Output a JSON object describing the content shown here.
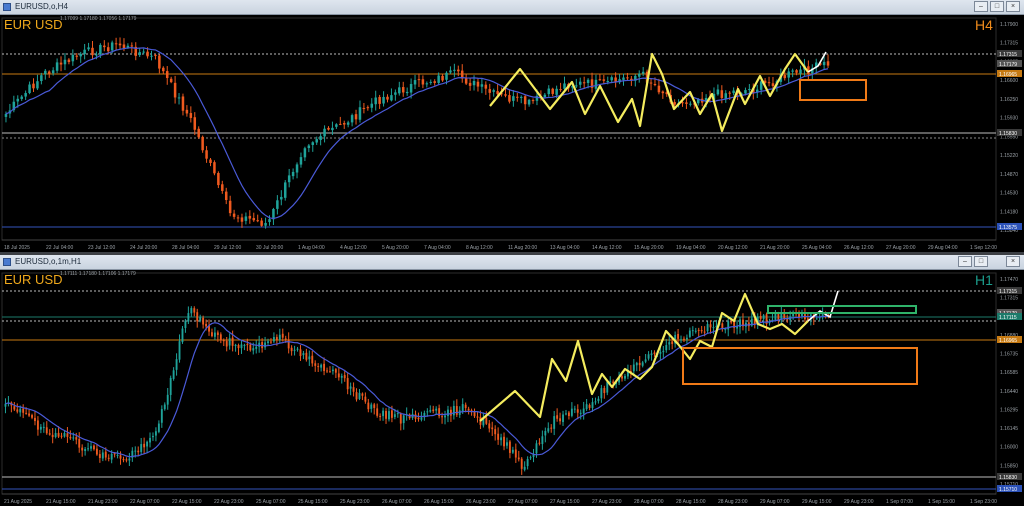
{
  "top": {
    "title": "EURUSD,o,H4",
    "symbol": "EUR USD",
    "timeframe": "H4",
    "timeframe_color": "#f08c1c",
    "ohlc": "1.17099 1.17180 1.17056 1.17179",
    "price_ticks": [
      "1.17900",
      "1.17315",
      "1.16965",
      "1.16600",
      "1.16250",
      "1.15930",
      "1.15550",
      "1.15220",
      "1.14870",
      "1.14530",
      "1.14180",
      "1.13840"
    ],
    "price_labels": [
      {
        "text": "1.17315",
        "color": "#ffffff",
        "bg": "#3a3a3a"
      },
      {
        "text": "1.17179",
        "color": "#ffffff",
        "bg": "#555555"
      },
      {
        "text": "1.16965",
        "color": "#ffffff",
        "bg": "#c77a12"
      },
      {
        "text": "1.15830",
        "color": "#ffffff",
        "bg": "#3a3a3a"
      },
      {
        "text": "1.13575",
        "color": "#ffffff",
        "bg": "#2c52b8"
      }
    ],
    "time_labels": [
      "18 Jul 2025",
      "22 Jul 04:00",
      "23 Jul 12:00",
      "24 Jul 20:00",
      "28 Jul 04:00",
      "29 Jul 12:00",
      "30 Jul 20:00",
      "1 Aug 04:00",
      "4 Aug 12:00",
      "5 Aug 20:00",
      "7 Aug 04:00",
      "8 Aug 12:00",
      "11 Aug 20:00",
      "13 Aug 04:00",
      "14 Aug 12:00",
      "15 Aug 20:00",
      "19 Aug 04:00",
      "20 Aug 12:00",
      "21 Aug 20:00",
      "25 Aug 04:00",
      "26 Aug 12:00",
      "27 Aug 20:00",
      "29 Aug 04:00",
      "1 Sep 12:00"
    ]
  },
  "bottom": {
    "title": "EURUSD,o,1m,H1",
    "symbol": "EUR USD",
    "timeframe": "H1",
    "timeframe_color": "#1c9c8c",
    "ohlc": "1.17111 1.17180 1.17106 1.17179",
    "price_ticks": [
      "1.17470",
      "1.17315",
      "1.17025",
      "1.16880",
      "1.16735",
      "1.16585",
      "1.16440",
      "1.16295",
      "1.16145",
      "1.16000",
      "1.15850",
      "1.15710"
    ],
    "price_labels": [
      {
        "text": "1.17315",
        "color": "#ffffff",
        "bg": "#3a3a3a"
      },
      {
        "text": "1.17179",
        "color": "#ffffff",
        "bg": "#555555"
      },
      {
        "text": "1.17115",
        "color": "#ffffff",
        "bg": "#1c7a6a"
      },
      {
        "text": "1.16965",
        "color": "#ffffff",
        "bg": "#c77a12"
      },
      {
        "text": "1.15830",
        "color": "#ffffff",
        "bg": "#3a3a3a"
      },
      {
        "text": "1.15710",
        "color": "#ffffff",
        "bg": "#2c52b8"
      }
    ],
    "time_labels": [
      "21 Aug 2025",
      "21 Aug 15:00",
      "21 Aug 23:00",
      "22 Aug 07:00",
      "22 Aug 15:00",
      "22 Aug 23:00",
      "25 Aug 07:00",
      "25 Aug 15:00",
      "25 Aug 23:00",
      "26 Aug 07:00",
      "26 Aug 15:00",
      "26 Aug 23:00",
      "27 Aug 07:00",
      "27 Aug 15:00",
      "27 Aug 23:00",
      "28 Aug 07:00",
      "28 Aug 15:00",
      "28 Aug 23:00",
      "29 Aug 07:00",
      "29 Aug 15:00",
      "29 Aug 23:00",
      "1 Sep 07:00",
      "1 Sep 15:00",
      "1 Sep 23:00"
    ]
  },
  "colors": {
    "bull": "#1fa39a",
    "bear": "#ef5a1f",
    "ma": "#4a5ad8",
    "zigzag": "#f4ec5e",
    "projection": "#ffffff",
    "zone_orange": "#f07a17",
    "zone_green": "#2fb36a",
    "level_orange": "#c77a12"
  },
  "icons": {
    "window": "chart-window-icon",
    "minimize": "minimize-icon",
    "maximize": "maximize-icon",
    "close": "close-icon"
  }
}
